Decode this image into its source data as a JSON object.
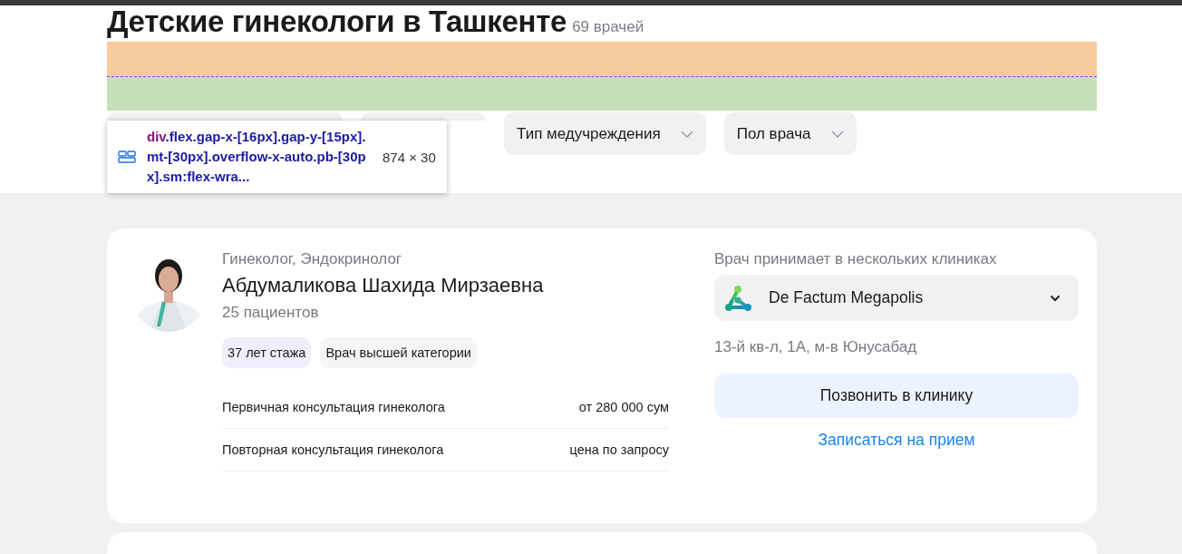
{
  "header": {
    "title": "Детские гинекологи в Ташкенте",
    "count": "69 врачей"
  },
  "filters": [
    {
      "kind": "covered"
    },
    {
      "kind": "covered"
    },
    {
      "kind": "dropdown",
      "label": "Тип медучреждения"
    },
    {
      "kind": "dropdown",
      "label": "Пол врача"
    }
  ],
  "inspector_tooltip": {
    "tag": "div",
    "selector": ".flex.gap-x-[16px].gap-y-[15px].mt-[30px].overflow-x-auto.pb-[30px].sm:flex-wra...",
    "size": "874 × 30"
  },
  "doctor_card": {
    "specialties": "Гинеколог, Эндокринолог",
    "name": "Абдумаликова Шахида Мирзаевна",
    "patients": "25 пациентов",
    "tags": [
      {
        "label": "37 лет стажа",
        "color": "#f0edfc"
      },
      {
        "label": "Врач высшей категории",
        "color": "#f5f5f6"
      }
    ],
    "services": [
      {
        "name": "Первичная консультация гинеколога",
        "price": "от 280 000 сум"
      },
      {
        "name": "Повторная консультация гинеколога",
        "price": "цена по запросу"
      }
    ],
    "clinics_label": "Врач принимает в нескольких клиниках",
    "clinic": {
      "name": "De Factum Megapolis",
      "expanded": false
    },
    "address": "13-й кв-л, 1А, м-в Юнусабад",
    "call_button": "Позвонить в клинику",
    "book_link": "Записаться на прием"
  }
}
